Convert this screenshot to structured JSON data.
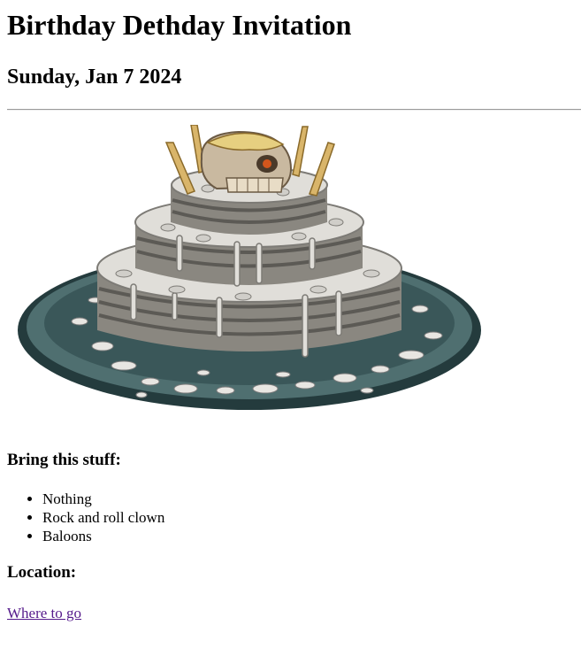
{
  "invitation": {
    "title": "Birthday Dethday Invitation",
    "date": "Sunday, Jan 7 2024"
  },
  "image": {
    "icon": "skull-birthday-cake-illustration",
    "colors": {
      "plate_dark": "#2f4a4d",
      "plate_mid": "#4f6f70",
      "cake_light": "#d9d7d2",
      "cake_dark": "#6d6a64",
      "candle": "#d9b56a",
      "skull": "#c9b9a0",
      "skull_eye": "#d2561c"
    }
  },
  "bring": {
    "heading": "Bring this stuff:",
    "items": [
      "Nothing",
      "Rock and roll clown",
      "Baloons"
    ]
  },
  "location": {
    "heading": "Location:",
    "link_text": "Where to go",
    "link_color": "#551a8b"
  }
}
